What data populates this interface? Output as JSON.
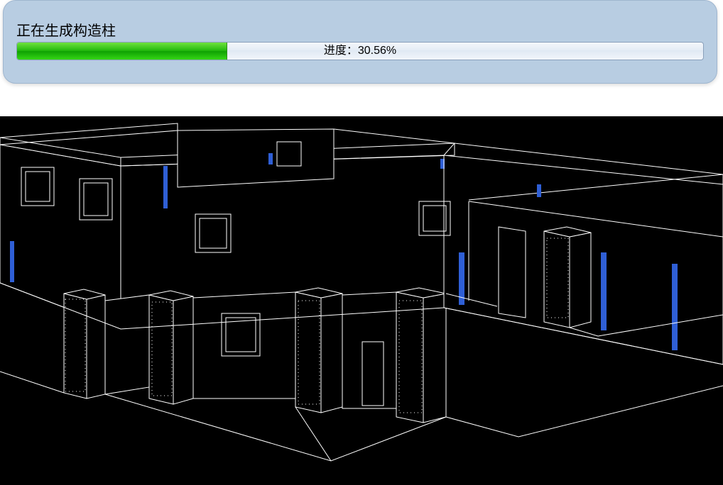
{
  "dialog": {
    "status_text": "正在生成构造柱",
    "progress_label": "进度：30.56%",
    "progress_percent": 30.56
  },
  "viewport": {
    "description": "3D isometric building model wireframe",
    "accent_color": "#2f5fd6",
    "line_color": "#ffffff",
    "bg_color": "#000000"
  }
}
